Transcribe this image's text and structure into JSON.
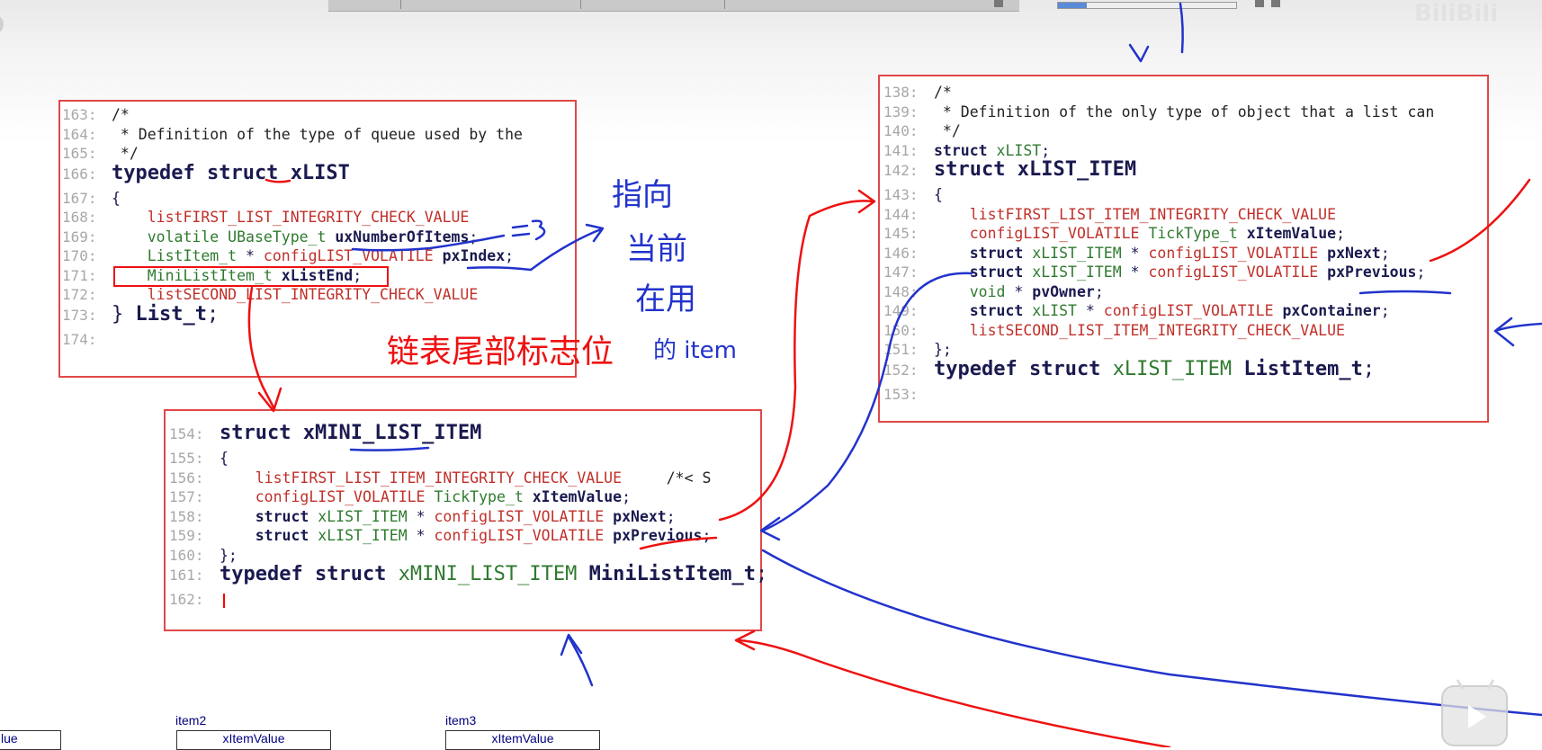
{
  "left_panel": {
    "lines": [
      {
        "ln": "163:",
        "tokens": [
          [
            "com",
            "/*"
          ]
        ]
      },
      {
        "ln": "164:",
        "tokens": [
          [
            "com",
            " * Definition of the type of queue used by the"
          ]
        ]
      },
      {
        "ln": "165:",
        "tokens": [
          [
            "com",
            " */"
          ]
        ]
      },
      {
        "ln": "166:",
        "title": true,
        "tokens": [
          [
            "kw",
            "typedef struct "
          ],
          [
            "big",
            "xLIST"
          ]
        ]
      },
      {
        "ln": "167:",
        "tokens": [
          [
            "plain",
            "{"
          ]
        ]
      },
      {
        "ln": "168:",
        "tokens": [
          [
            "plain",
            "    "
          ],
          [
            "macro",
            "listFIRST_LIST_INTEGRITY_CHECK_VALUE"
          ]
        ]
      },
      {
        "ln": "169:",
        "tokens": [
          [
            "plain",
            "    "
          ],
          [
            "type",
            "volatile UBaseType_t "
          ],
          [
            "id",
            "uxNumberOfItems"
          ],
          [
            "plain",
            ";"
          ]
        ]
      },
      {
        "ln": "170:",
        "tokens": [
          [
            "plain",
            "    "
          ],
          [
            "type",
            "ListItem_t "
          ],
          [
            "plain",
            "* "
          ],
          [
            "macro",
            "configLIST_VOLATILE "
          ],
          [
            "id",
            "pxIndex"
          ],
          [
            "plain",
            ";"
          ]
        ]
      },
      {
        "ln": "171:",
        "tokens": [
          [
            "plain",
            "    "
          ],
          [
            "type",
            "MiniListItem_t "
          ],
          [
            "id",
            "xListEnd"
          ],
          [
            "plain",
            ";"
          ]
        ]
      },
      {
        "ln": "172:",
        "tokens": [
          [
            "plain",
            "    "
          ],
          [
            "macro",
            "listSECOND_LIST_INTEGRITY_CHECK_VALUE"
          ]
        ]
      },
      {
        "ln": "173:",
        "title": true,
        "tokens": [
          [
            "plain",
            "} "
          ],
          [
            "big",
            "List_t"
          ],
          [
            "plain",
            ";"
          ]
        ]
      },
      {
        "ln": "174:",
        "tokens": []
      }
    ]
  },
  "right_panel": {
    "lines": [
      {
        "ln": "138:",
        "tokens": [
          [
            "com",
            "/*"
          ]
        ]
      },
      {
        "ln": "139:",
        "tokens": [
          [
            "com",
            " * Definition of the only type of object that a list can"
          ]
        ]
      },
      {
        "ln": "140:",
        "tokens": [
          [
            "com",
            " */"
          ]
        ]
      },
      {
        "ln": "141:",
        "tokens": [
          [
            "kw",
            "struct "
          ],
          [
            "type",
            "xLIST"
          ],
          [
            "plain",
            ";"
          ]
        ]
      },
      {
        "ln": "142:",
        "title": true,
        "tokens": [
          [
            "kw",
            "struct "
          ],
          [
            "big",
            "xLIST_ITEM"
          ]
        ]
      },
      {
        "ln": "143:",
        "tokens": [
          [
            "plain",
            "{"
          ]
        ]
      },
      {
        "ln": "144:",
        "tokens": [
          [
            "plain",
            "    "
          ],
          [
            "macro",
            "listFIRST_LIST_ITEM_INTEGRITY_CHECK_VALUE"
          ]
        ]
      },
      {
        "ln": "145:",
        "tokens": [
          [
            "plain",
            "    "
          ],
          [
            "macro",
            "configLIST_VOLATILE "
          ],
          [
            "type",
            "TickType_t "
          ],
          [
            "id",
            "xItemValue"
          ],
          [
            "plain",
            ";"
          ]
        ]
      },
      {
        "ln": "146:",
        "tokens": [
          [
            "plain",
            "    "
          ],
          [
            "kw",
            "struct "
          ],
          [
            "type",
            "xLIST_ITEM "
          ],
          [
            "plain",
            "* "
          ],
          [
            "macro",
            "configLIST_VOLATILE "
          ],
          [
            "id",
            "pxNext"
          ],
          [
            "plain",
            ";"
          ]
        ]
      },
      {
        "ln": "147:",
        "tokens": [
          [
            "plain",
            "    "
          ],
          [
            "kw",
            "struct "
          ],
          [
            "type",
            "xLIST_ITEM "
          ],
          [
            "plain",
            "* "
          ],
          [
            "macro",
            "configLIST_VOLATILE "
          ],
          [
            "id",
            "pxPrevious"
          ],
          [
            "plain",
            ";"
          ]
        ]
      },
      {
        "ln": "148:",
        "tokens": [
          [
            "plain",
            "    "
          ],
          [
            "type",
            "void "
          ],
          [
            "plain",
            "* "
          ],
          [
            "id",
            "pvOwner"
          ],
          [
            "plain",
            ";"
          ]
        ]
      },
      {
        "ln": "149:",
        "tokens": [
          [
            "plain",
            "    "
          ],
          [
            "kw",
            "struct "
          ],
          [
            "type",
            "xLIST "
          ],
          [
            "plain",
            "* "
          ],
          [
            "macro",
            "configLIST_VOLATILE "
          ],
          [
            "id",
            "pxContainer"
          ],
          [
            "plain",
            ";"
          ]
        ]
      },
      {
        "ln": "150:",
        "tokens": [
          [
            "plain",
            "    "
          ],
          [
            "macro",
            "listSECOND_LIST_ITEM_INTEGRITY_CHECK_VALUE"
          ]
        ]
      },
      {
        "ln": "151:",
        "tokens": [
          [
            "plain",
            "};"
          ]
        ]
      },
      {
        "ln": "152:",
        "title": true,
        "tokens": [
          [
            "kw",
            "typedef struct "
          ],
          [
            "type",
            "xLIST_ITEM "
          ],
          [
            "big",
            "ListItem_t"
          ],
          [
            "plain",
            ";"
          ]
        ]
      },
      {
        "ln": "153:",
        "tokens": []
      }
    ]
  },
  "mini_panel": {
    "lines": [
      {
        "ln": "154:",
        "title": true,
        "tokens": [
          [
            "kw",
            "struct "
          ],
          [
            "big",
            "xMINI_LIST_ITEM"
          ]
        ]
      },
      {
        "ln": "155:",
        "tokens": [
          [
            "plain",
            "{"
          ]
        ]
      },
      {
        "ln": "156:",
        "tokens": [
          [
            "plain",
            "    "
          ],
          [
            "macro",
            "listFIRST_LIST_ITEM_INTEGRITY_CHECK_VALUE"
          ],
          [
            "com",
            "     /*< S"
          ]
        ]
      },
      {
        "ln": "157:",
        "tokens": [
          [
            "plain",
            "    "
          ],
          [
            "macro",
            "configLIST_VOLATILE "
          ],
          [
            "type",
            "TickType_t "
          ],
          [
            "id",
            "xItemValue"
          ],
          [
            "plain",
            ";"
          ]
        ]
      },
      {
        "ln": "158:",
        "tokens": [
          [
            "plain",
            "    "
          ],
          [
            "kw",
            "struct "
          ],
          [
            "type",
            "xLIST_ITEM "
          ],
          [
            "plain",
            "* "
          ],
          [
            "macro",
            "configLIST_VOLATILE "
          ],
          [
            "id",
            "pxNext"
          ],
          [
            "plain",
            ";"
          ]
        ]
      },
      {
        "ln": "159:",
        "tokens": [
          [
            "plain",
            "    "
          ],
          [
            "kw",
            "struct "
          ],
          [
            "type",
            "xLIST_ITEM "
          ],
          [
            "plain",
            "* "
          ],
          [
            "macro",
            "configLIST_VOLATILE "
          ],
          [
            "id",
            "pxPrevious"
          ],
          [
            "plain",
            ";"
          ]
        ]
      },
      {
        "ln": "160:",
        "tokens": [
          [
            "plain",
            "};"
          ]
        ]
      },
      {
        "ln": "161:",
        "title": true,
        "tokens": [
          [
            "kw",
            "typedef struct "
          ],
          [
            "type",
            "xMINI_LIST_ITEM "
          ],
          [
            "big",
            "MiniListItem_t"
          ],
          [
            "plain",
            ";"
          ]
        ]
      },
      {
        "ln": "162:",
        "caret": true,
        "tokens": []
      }
    ]
  },
  "annotations": {
    "tail_flag": "链表尾部标志位",
    "handwriting_lines": [
      "指向",
      "当前",
      "在用",
      "的 item"
    ]
  },
  "bottom_items": [
    {
      "name": "",
      "field": "lue"
    },
    {
      "name": "item2",
      "field": "xItemValue"
    },
    {
      "name": "item3",
      "field": "xItemValue"
    }
  ],
  "watermark": "BiliBili",
  "colors": {
    "frame": "#e04848",
    "ink_red": "#ee1111",
    "ink_blue": "#2233cc"
  }
}
